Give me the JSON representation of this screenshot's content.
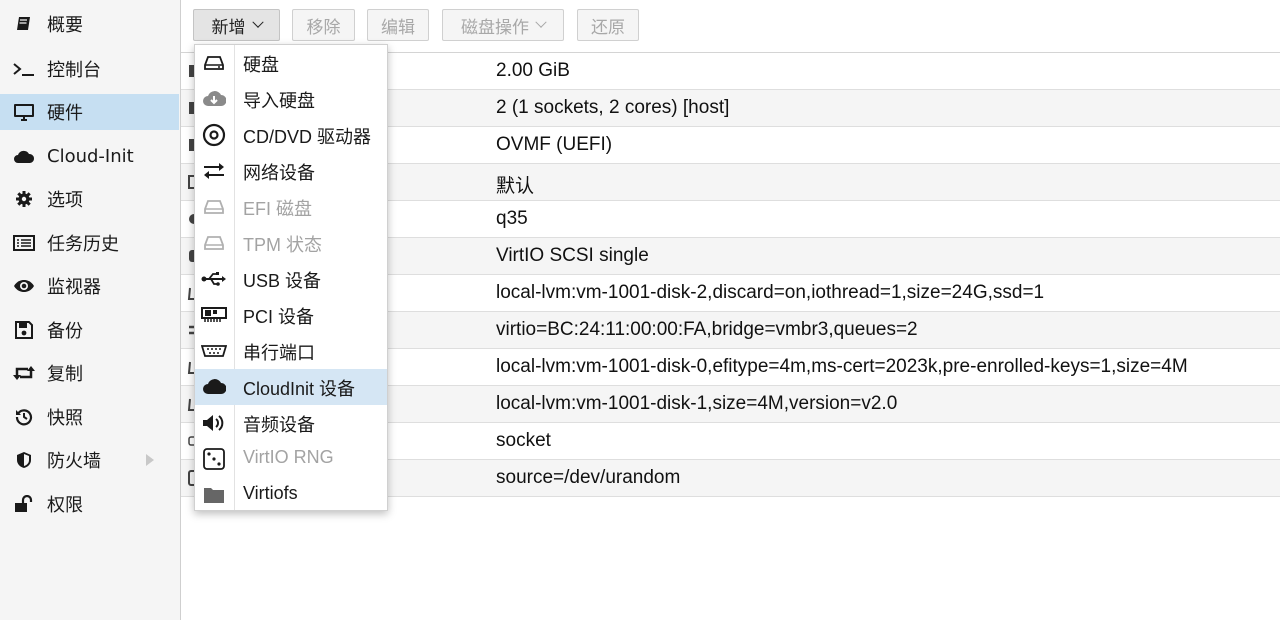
{
  "sidebar": {
    "items": [
      {
        "label": "概要",
        "icon": "book-icon"
      },
      {
        "label": "控制台",
        "icon": "terminal-icon"
      },
      {
        "label": "硬件",
        "icon": "monitor-icon",
        "active": true
      },
      {
        "label": "Cloud-Init",
        "icon": "cloud-icon"
      },
      {
        "label": "选项",
        "icon": "gear-icon"
      },
      {
        "label": "任务历史",
        "icon": "list-icon"
      },
      {
        "label": "监视器",
        "icon": "eye-icon"
      },
      {
        "label": "备份",
        "icon": "floppy-icon"
      },
      {
        "label": "复制",
        "icon": "retweet-icon"
      },
      {
        "label": "快照",
        "icon": "history-icon"
      },
      {
        "label": "防火墙",
        "icon": "shield-icon",
        "expandable": true
      },
      {
        "label": "权限",
        "icon": "unlock-icon"
      }
    ]
  },
  "toolbar": {
    "add_label": "新增",
    "remove_label": "移除",
    "edit_label": "编辑",
    "disk_action_label": "磁盘操作",
    "revert_label": "还原"
  },
  "hardware_rows": [
    {
      "value": "2.00 GiB"
    },
    {
      "value": "2 (1 sockets, 2 cores) [host]"
    },
    {
      "value": "OVMF (UEFI)"
    },
    {
      "value": "默认"
    },
    {
      "value": "q35"
    },
    {
      "value": "VirtIO SCSI single"
    },
    {
      "value": "local-lvm:vm-1001-disk-2,discard=on,iothread=1,size=24G,ssd=1"
    },
    {
      "value": "virtio=BC:24:11:00:00:FA,bridge=vmbr3,queues=2"
    },
    {
      "value": "local-lvm:vm-1001-disk-0,efitype=4m,ms-cert=2023k,pre-enrolled-keys=1,size=4M"
    },
    {
      "value": "local-lvm:vm-1001-disk-1,size=4M,version=v2.0"
    },
    {
      "value": "socket"
    },
    {
      "value": "source=/dev/urandom"
    }
  ],
  "add_menu": {
    "items": [
      {
        "label": "硬盘",
        "icon": "hdd-icon",
        "disabled": false
      },
      {
        "label": "导入硬盘",
        "icon": "cloud-download-icon",
        "disabled": false
      },
      {
        "label": "CD/DVD 驱动器",
        "icon": "optical-disc-icon",
        "disabled": false
      },
      {
        "label": "网络设备",
        "icon": "exchange-icon",
        "disabled": false
      },
      {
        "label": "EFI 磁盘",
        "icon": "hdd-icon",
        "disabled": true
      },
      {
        "label": "TPM 状态",
        "icon": "hdd-icon",
        "disabled": true
      },
      {
        "label": "USB 设备",
        "icon": "usb-icon",
        "disabled": false
      },
      {
        "label": "PCI 设备",
        "icon": "pci-card-icon",
        "disabled": false
      },
      {
        "label": "串行端口",
        "icon": "serial-port-icon",
        "disabled": false
      },
      {
        "label": "CloudInit 设备",
        "icon": "cloud-icon",
        "disabled": false,
        "active": true
      },
      {
        "label": "音频设备",
        "icon": "volume-icon",
        "disabled": false
      },
      {
        "label": "VirtIO RNG",
        "icon": "dice-icon",
        "disabled": true
      },
      {
        "label": "Virtiofs",
        "icon": "folder-icon",
        "disabled": false
      }
    ]
  },
  "colors": {
    "selection": "#c6dff2",
    "menu_hover": "#d5e6f4",
    "sidebar_bg": "#f5f5f5"
  }
}
